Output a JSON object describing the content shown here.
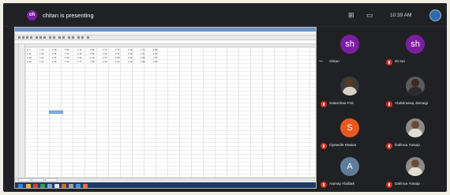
{
  "topbar": {
    "presenter_initials": "ch",
    "presenting_text": "chitan is presenting",
    "clock": "10:39 AM"
  },
  "spreadsheet": {
    "rows": [
      [
        "1.1",
        "1.14",
        "1.79",
        "1.80",
        "1.12",
        "1.80",
        "2.74",
        "1.74",
        "1.02",
        "1.74",
        "1.80"
      ],
      [
        "1.42",
        "1.93",
        "2.64",
        "1.30",
        "1.45",
        "2.58",
        "1.90",
        "1.94",
        "1.60",
        "1.01",
        "1.40"
      ],
      [
        "1.10",
        "1.22",
        "1.35",
        "1.65",
        "1.40",
        "1.40",
        "1.43",
        "1.86",
        "1.53",
        "1.90",
        "1.70"
      ],
      [
        "1.20",
        "1.41",
        "1.40",
        "1.40",
        "1.14",
        "1.30",
        "1.30",
        "1.02",
        "1.14",
        "1.80",
        "1.60"
      ]
    ]
  },
  "participants": [
    {
      "name": "chitan",
      "initials": "sh",
      "avatar_color": "#7b1fa2",
      "type": "initials",
      "pinned_mark": "•••"
    },
    {
      "name": "sh ton",
      "initials": "sh",
      "avatar_color": "#7b1fa2",
      "type": "initials"
    },
    {
      "name": "Salamhaa Foli",
      "initials": "",
      "avatar_color": "#3a3a3a",
      "type": "photo",
      "skin": "#5a3a26",
      "shirt": "#d8d0c4"
    },
    {
      "name": "Abdulrasaq Jamaigi",
      "initials": "",
      "avatar_color": "#5a5a5a",
      "type": "photo",
      "skin": "#3e2a1e",
      "shirt": "#2c2c2c"
    },
    {
      "name": "Oyewole Matias",
      "initials": "S",
      "avatar_color": "#e8581f",
      "type": "initials"
    },
    {
      "name": "Dalinua Yusuip",
      "initials": "",
      "avatar_color": "#8c8a86",
      "type": "photo",
      "skin": "#6b4a35",
      "shirt": "#e2ddd3"
    },
    {
      "name": "Aamay Abditak",
      "initials": "A",
      "avatar_color": "#5f7d9a",
      "type": "initials"
    },
    {
      "name": "Dalinua Yusuip",
      "initials": "",
      "avatar_color": "#8c8a86",
      "type": "photo",
      "skin": "#6b4a35",
      "shirt": "#e2ddd3"
    }
  ]
}
